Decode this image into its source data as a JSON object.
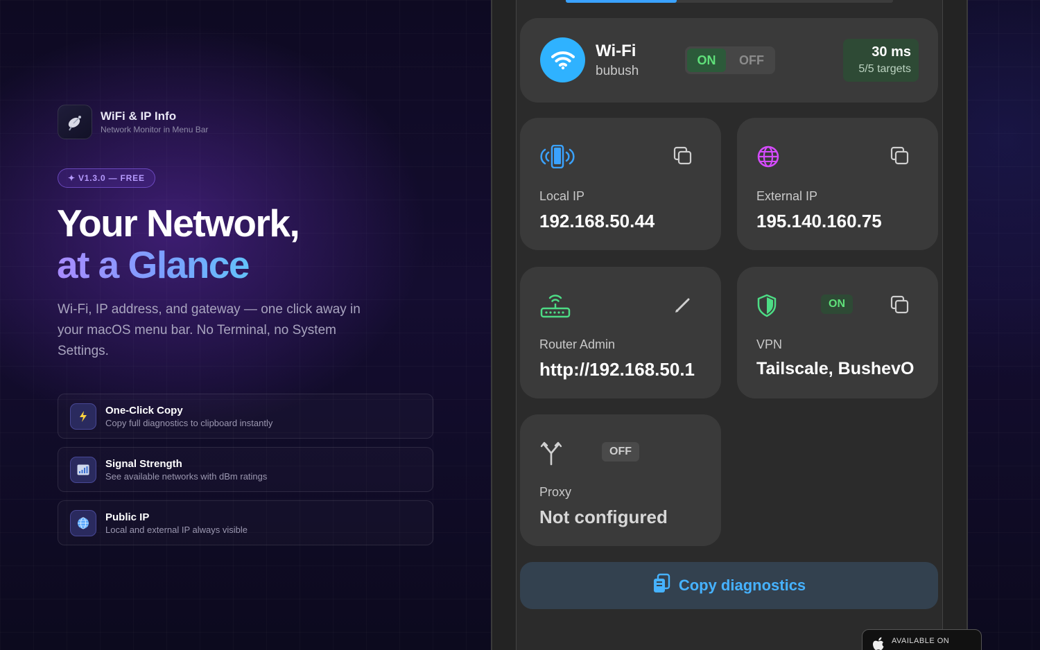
{
  "brand": {
    "title": "WiFi & IP Info",
    "subtitle": "Network Monitor in Menu Bar"
  },
  "version_pill": "✦ V1.3.0 — FREE",
  "headline": {
    "line1": "Your Network,",
    "line2": "at a Glance"
  },
  "description": "Wi-Fi, IP address, and gateway — one click away in your macOS menu bar. No Terminal, no System Settings.",
  "features": [
    {
      "icon": "lightning-icon",
      "title": "One-Click Copy",
      "desc": "Copy full diagnostics to clipboard instantly"
    },
    {
      "icon": "signal-chart-icon",
      "title": "Signal Strength",
      "desc": "See available networks with dBm ratings"
    },
    {
      "icon": "globe-icon",
      "title": "Public IP",
      "desc": "Local and external IP always visible"
    }
  ],
  "panel": {
    "wifi": {
      "name": "Wi-Fi",
      "ssid": "bubush",
      "toggle_on": "ON",
      "toggle_off": "OFF",
      "ping": "30 ms",
      "targets": "5/5 targets"
    },
    "local_ip": {
      "label": "Local IP",
      "value": "192.168.50.44"
    },
    "external_ip": {
      "label": "External IP",
      "value": "195.140.160.75"
    },
    "router": {
      "label": "Router Admin",
      "value": "http://192.168.50.1"
    },
    "vpn": {
      "label": "VPN",
      "value": "Tailscale, BushevO",
      "status": "ON"
    },
    "proxy": {
      "label": "Proxy",
      "value": "Not configured",
      "status": "OFF"
    },
    "copy_button": "Copy diagnostics"
  },
  "store_badge": {
    "line1": "AVAILABLE ON"
  },
  "colors": {
    "accent_blue": "#2fb2ff",
    "on_green": "#5fe07a",
    "purple": "#b79cff"
  }
}
